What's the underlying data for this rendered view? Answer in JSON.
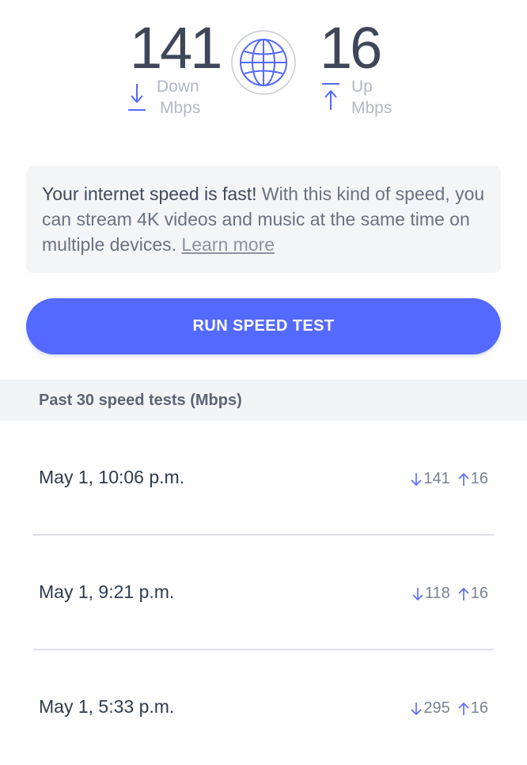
{
  "summary": {
    "download": "141",
    "download_unit_line1": "Down",
    "download_unit_line2": "Mbps",
    "upload": "16",
    "upload_unit_line1": "Up",
    "upload_unit_line2": "Mbps",
    "globe_icon": "globe-icon",
    "accent_color": "#5469ff"
  },
  "message": {
    "headline": "Your internet speed is fast!",
    "body": " With this kind of speed, you can stream 4K videos and music at the same time on multiple devices. ",
    "link": "Learn more"
  },
  "actions": {
    "run_label": "RUN SPEED TEST"
  },
  "history": {
    "header": "Past 30 speed tests (Mbps)",
    "rows": [
      {
        "date": "May 1, 10:06 p.m.",
        "down": "141",
        "up": "16"
      },
      {
        "date": "May 1, 9:21 p.m.",
        "down": "118",
        "up": "16"
      },
      {
        "date": "May 1, 5:33 p.m.",
        "down": "295",
        "up": "16"
      }
    ]
  }
}
